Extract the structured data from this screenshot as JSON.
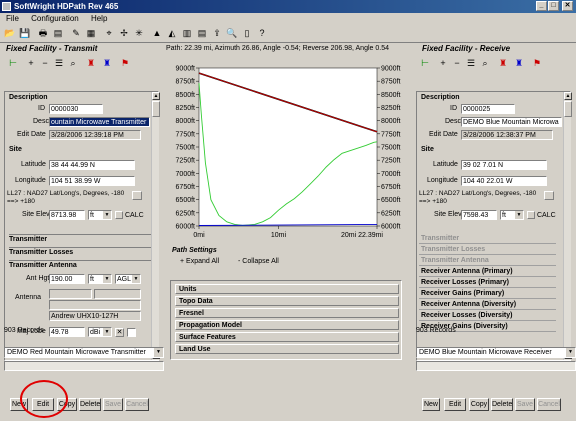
{
  "window": {
    "title": "SoftWright HDPath Rev 465"
  },
  "menu": [
    "File",
    "Configuration",
    "Help"
  ],
  "path_info": "Path: 22.39 mi, Azimuth 26.86, Angle -0.54; Reverse 206.98, Angle 0.54",
  "transmit": {
    "panel_title": "Fixed Facility - Transmit",
    "description_header": "Description",
    "id_label": "ID",
    "id_value": "0000030",
    "desc_label": "Desc",
    "desc_value": "ountain Microwave Transmitter",
    "edit_date_label": "Edit Date",
    "edit_date_value": "3/28/2006 12:39:18 PM",
    "site_header": "Site",
    "lat_label": "Latitude",
    "lat_value": "38 44 44.99 N",
    "lon_label": "Longitude",
    "lon_value": "104 51 38.99 W",
    "ll27_text": "LL27 : NAD27 Lat/Long's, Degrees, -180 ==> +180",
    "elev_label": "Site Elev",
    "elev_value": "8713.98",
    "elev_unit": "ft",
    "calc_label": "CALC",
    "transmitter_header": "Transmitter",
    "losses_header": "Transmitter Losses",
    "antenna_header": "Transmitter Antenna",
    "ant_hgt_label": "Ant Hgt",
    "ant_hgt_value": "190.00",
    "ant_hgt_unit": "ft",
    "ant_hgt_ref": "AGL",
    "antenna_label": "Antenna",
    "antenna_model": "Andrew UHX10-127H",
    "maj_lobe_label": "Maj Lobe",
    "maj_lobe_value": "49.78",
    "maj_lobe_unit": "dBi",
    "records": "903 Records",
    "selected_record": "DEMO Red Mountain Microwave Transmitter",
    "buttons": [
      "New",
      "Edit",
      "Copy",
      "Delete",
      "Save",
      "Cancel"
    ]
  },
  "receive": {
    "panel_title": "Fixed Facility - Receive",
    "description_header": "Description",
    "id_label": "ID",
    "id_value": "0000025",
    "desc_label": "Desc",
    "desc_value": "DEMO Blue Mountain Microwa",
    "edit_date_label": "Edit Date",
    "edit_date_value": "3/28/2006 12:38:37 PM",
    "site_header": "Site",
    "lat_label": "Latitude",
    "lat_value": "39 02 7.01 N",
    "lon_label": "Longitude",
    "lon_value": "104 40 22.01 W",
    "ll27_text": "LL27 : NAD27 Lat/Long's, Degrees, -180 ==> +180",
    "elev_label": "Site Elev",
    "elev_value": "7598.43",
    "elev_unit": "ft",
    "calc_label": "CALC",
    "items": [
      {
        "label": "Transmitter",
        "enabled": false
      },
      {
        "label": "Transmitter Losses",
        "enabled": false
      },
      {
        "label": "Transmitter Antenna",
        "enabled": false
      },
      {
        "label": "Receiver Antenna (Primary)",
        "enabled": true
      },
      {
        "label": "Receiver Losses (Primary)",
        "enabled": true
      },
      {
        "label": "Receiver Gains (Primary)",
        "enabled": true
      },
      {
        "label": "Receiver Antenna (Diversity)",
        "enabled": true
      },
      {
        "label": "Receiver Losses (Diversity)",
        "enabled": true
      },
      {
        "label": "Receiver Gains (Diversity)",
        "enabled": true
      }
    ],
    "records": "903 Records",
    "selected_record": "DEMO Blue Mountain Microwave Receiver",
    "buttons": [
      "New",
      "Edit",
      "Copy",
      "Delete",
      "Save",
      "Cancel"
    ]
  },
  "path_settings": {
    "title": "Path Settings",
    "expand_all": "+ Expand All",
    "collapse_all": "- Collapse All",
    "sections": [
      "Units",
      "Topo Data",
      "Fresnel",
      "Propagation Model",
      "Surface Features",
      "Land Use"
    ]
  },
  "chart_data": {
    "type": "line",
    "left_ticks": [
      "9000ft",
      "8750ft",
      "8500ft",
      "8250ft",
      "8000ft",
      "7750ft",
      "7500ft",
      "7250ft",
      "7000ft",
      "6750ft",
      "6500ft",
      "6250ft",
      "6000ft"
    ],
    "right_ticks": [
      "9000ft",
      "8750ft",
      "8500ft",
      "8250ft",
      "8000ft",
      "7750ft",
      "7500ft",
      "7250ft",
      "7000ft",
      "6750ft",
      "6500ft",
      "6250ft",
      "6000ft"
    ],
    "x_ticks": [
      "0mi",
      "10mi",
      "20mi 22.39mi"
    ],
    "ylim": [
      6000,
      9000
    ],
    "xlim": [
      0,
      22.39
    ],
    "series": [
      {
        "color": "#000000",
        "x": [
          0,
          22.39
        ],
        "y": [
          8904,
          7788
        ]
      },
      {
        "color": "#cc0000",
        "x": [
          0,
          22.39
        ],
        "y": [
          8904,
          7788
        ]
      },
      {
        "color": "#33cc33",
        "x": [
          0,
          0.3,
          0.8,
          1.5,
          2.5,
          3.5,
          4.5,
          5.5,
          7,
          8,
          9,
          10,
          11,
          12,
          13,
          14,
          15,
          16,
          17,
          18,
          19,
          20,
          21,
          22,
          22.39
        ],
        "y": [
          8713,
          8100,
          7200,
          6500,
          6200,
          6080,
          6030,
          6010,
          6030,
          6080,
          6160,
          6300,
          6420,
          6520,
          6650,
          6800,
          6950,
          7120,
          7260,
          7380,
          7430,
          7480,
          7530,
          7590,
          7598
        ]
      },
      {
        "color": "#0000cc",
        "x": [
          0,
          22.39
        ],
        "y": [
          6010,
          6030
        ]
      }
    ]
  }
}
